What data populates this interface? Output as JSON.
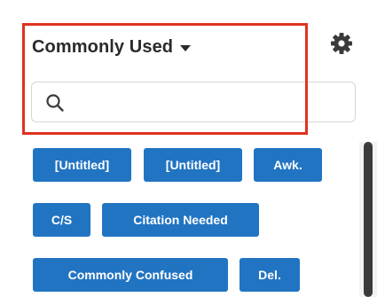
{
  "header": {
    "dropdown_label": "Commonly Used",
    "dropdown_icon": "caret-down-icon",
    "settings_icon": "gear-icon"
  },
  "search": {
    "placeholder": "",
    "value": "",
    "icon": "search-icon"
  },
  "tags": [
    {
      "label": "[Untitled]"
    },
    {
      "label": "[Untitled]"
    },
    {
      "label": "Awk."
    },
    {
      "label": "C/S"
    },
    {
      "label": "Citation Needed"
    },
    {
      "label": "Commonly Confused"
    },
    {
      "label": "Del."
    }
  ],
  "colors": {
    "tag_background": "#2174c2",
    "tag_text": "#ffffff",
    "highlight_border": "#e0321f",
    "text": "#2a2a2a"
  }
}
